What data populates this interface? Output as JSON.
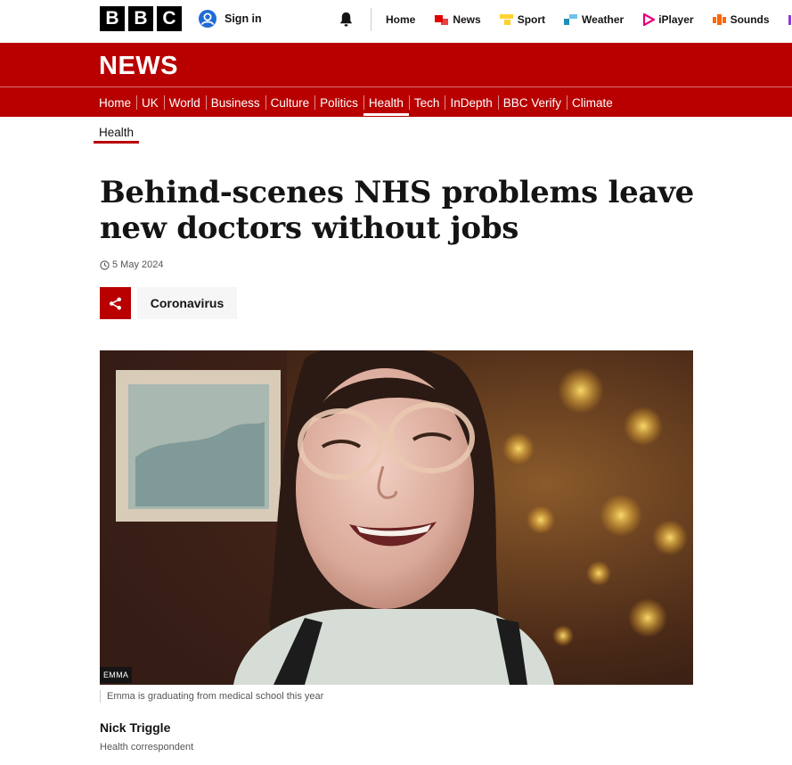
{
  "masthead": {
    "logo_letters": [
      "B",
      "B",
      "C"
    ],
    "sign_in_label": "Sign in",
    "nav": [
      {
        "label": "Home",
        "icon": "none",
        "color": ""
      },
      {
        "label": "News",
        "icon": "news-icon",
        "color": "#e00000"
      },
      {
        "label": "Sport",
        "icon": "sport-icon",
        "color": "#ffd230"
      },
      {
        "label": "Weather",
        "icon": "weather-icon",
        "color": "#1f8eb9"
      },
      {
        "label": "iPlayer",
        "icon": "iplayer-icon",
        "color": "#e5007d"
      },
      {
        "label": "Sounds",
        "icon": "sounds-icon",
        "color": "#ff6600"
      },
      {
        "label": "B",
        "icon": "bitesize-icon",
        "color": "#8a3cdb"
      }
    ]
  },
  "news_bar": {
    "wordmark": "NEWS",
    "brand_color": "#b80000",
    "sections": [
      "Home",
      "UK",
      "World",
      "Business",
      "Culture",
      "Politics",
      "Health",
      "Tech",
      "InDepth",
      "BBC Verify",
      "Climate"
    ],
    "active_section": "Health"
  },
  "breadcrumb": {
    "label": "Health"
  },
  "article": {
    "headline": "Behind-scenes NHS problems leave new doctors without jobs",
    "date": "5 May 2024",
    "topic_tag": "Coronavirus",
    "image": {
      "credit": "EMMA",
      "caption": "Emma is graduating from medical school this year"
    },
    "byline": {
      "name": "Nick Triggle",
      "role": "Health correspondent"
    }
  }
}
